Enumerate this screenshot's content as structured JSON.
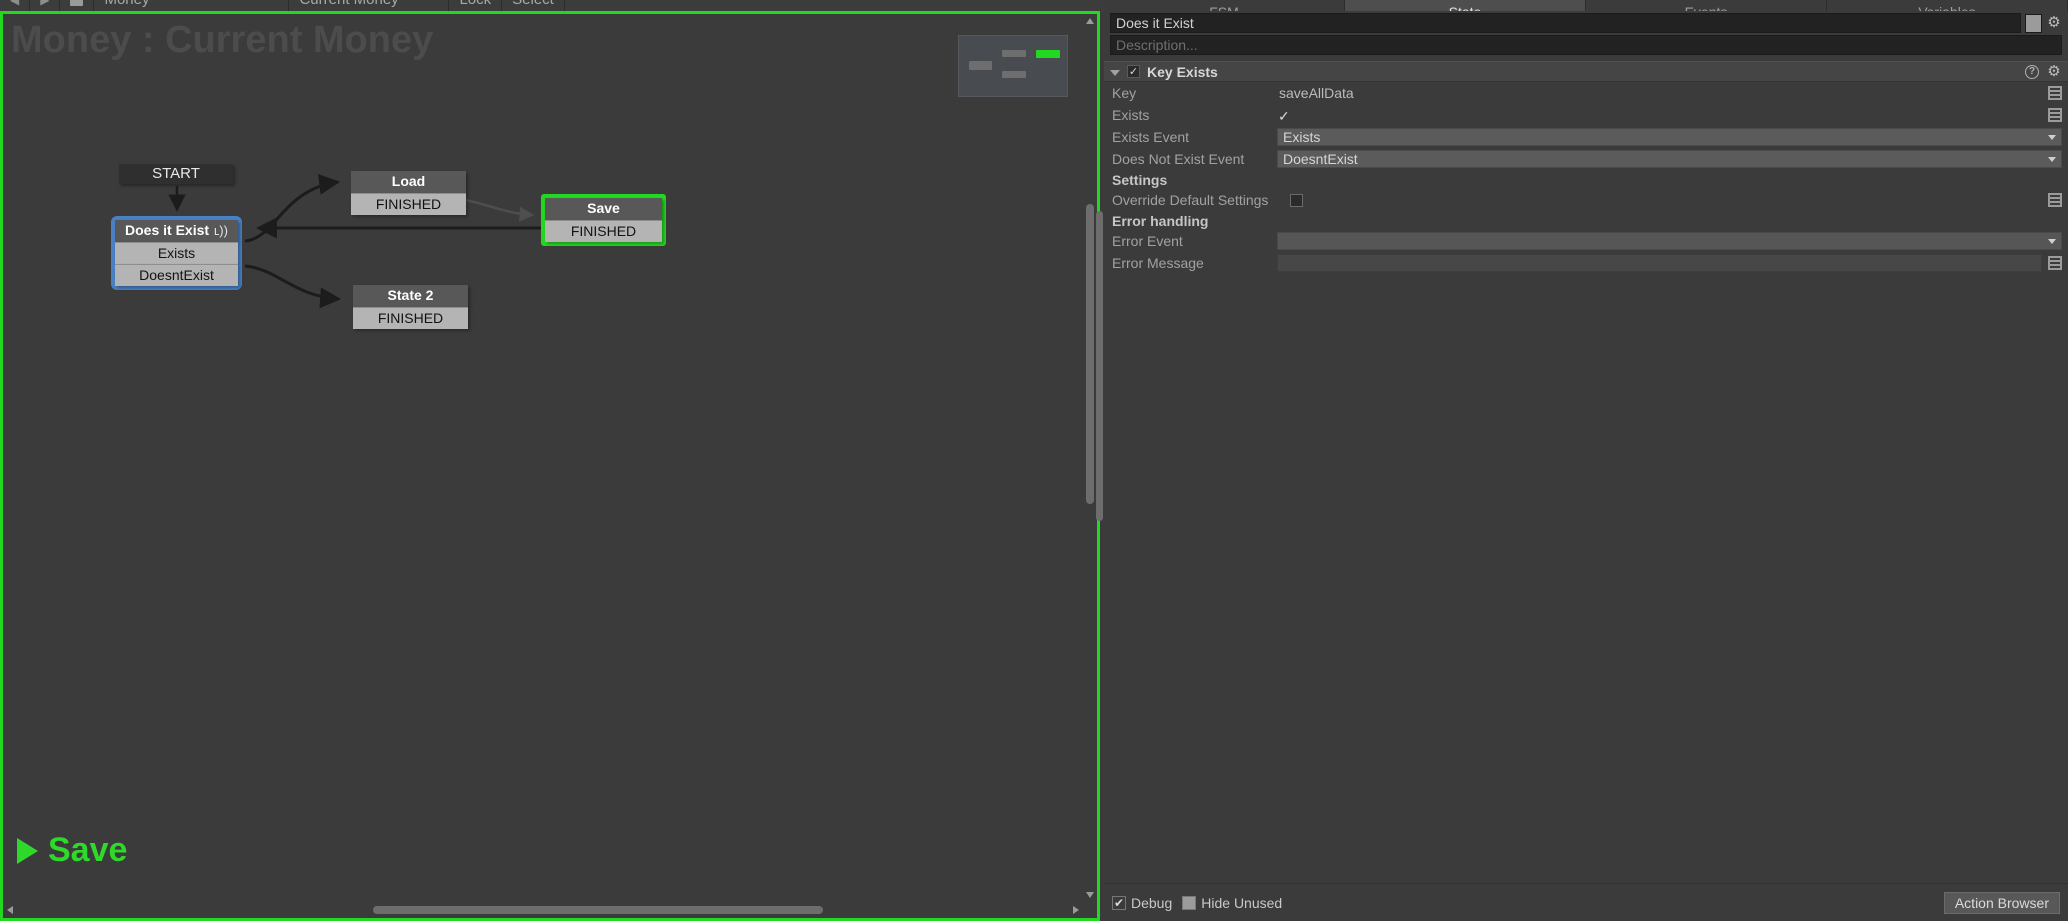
{
  "toolbar": {
    "back_arrow": "◀",
    "forward_arrow": "▶",
    "owner_label": "Money",
    "fsm_label": "Current Money",
    "lock_label": "Lock",
    "select_label": "Select"
  },
  "graph": {
    "title": "Money : Current Money",
    "active_state_label": "Save",
    "nodes": [
      {
        "name": "START",
        "events": []
      },
      {
        "name": "Does it Exist",
        "broadcast": "ʟ))",
        "events": [
          "Exists",
          "DoesntExist"
        ],
        "selected": "blue"
      },
      {
        "name": "Load",
        "events": [
          "FINISHED"
        ]
      },
      {
        "name": "Save",
        "events": [
          "FINISHED"
        ],
        "selected": "green"
      },
      {
        "name": "State 2",
        "events": [
          "FINISHED"
        ]
      }
    ],
    "minimap": {
      "accent_color": "#23d820"
    }
  },
  "inspector": {
    "tabs": [
      {
        "label": "FSM",
        "active": false
      },
      {
        "label": "State",
        "active": true
      },
      {
        "label": "Events",
        "active": false
      },
      {
        "label": "Variables",
        "active": false
      }
    ],
    "state_name": "Does it Exist",
    "description_placeholder": "Description...",
    "action": {
      "title": "Key Exists",
      "enabled_check": "✓",
      "help_icon": "?",
      "gear_icon": "⚙",
      "fields": [
        {
          "label": "Key",
          "type": "text",
          "value": "saveAllData"
        },
        {
          "label": "Exists",
          "type": "checkbox",
          "checked": true,
          "check_glyph": "✓"
        },
        {
          "label": "Exists Event",
          "type": "dropdown",
          "value": "Exists"
        },
        {
          "label": "Does Not Exist Event",
          "type": "dropdown",
          "value": "DoesntExist"
        }
      ],
      "settings_section": "Settings",
      "settings_fields": [
        {
          "label": "Override Default Settings",
          "type": "checkbox",
          "checked": false
        }
      ],
      "error_section": "Error handling",
      "error_fields": [
        {
          "label": "Error Event",
          "type": "dropdown",
          "value": ""
        },
        {
          "label": "Error Message",
          "type": "textfield",
          "value": ""
        }
      ]
    }
  },
  "bottom": {
    "debug_label": "Debug",
    "debug_checked": true,
    "debug_glyph": "✔",
    "hide_unused_label": "Hide Unused",
    "hide_unused_checked": false,
    "action_browser_label": "Action Browser"
  },
  "colors": {
    "selection_green": "#23d820",
    "selection_blue": "#4981c4",
    "canvas_bg": "#3b3b3b"
  }
}
